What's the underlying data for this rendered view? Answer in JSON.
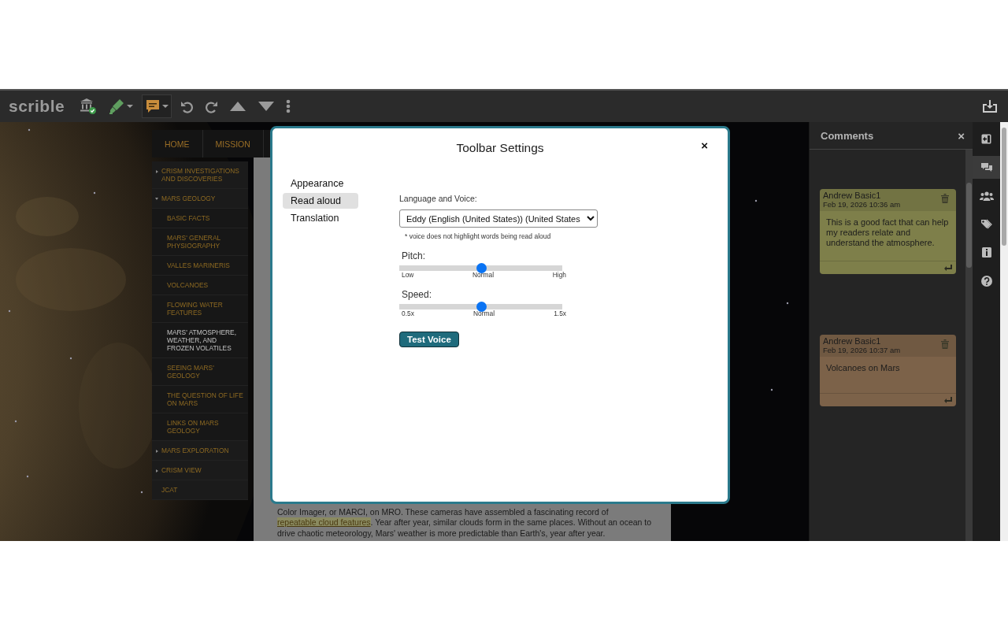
{
  "toolbar": {
    "logo": "scrible",
    "tools": [
      {
        "kind": "library",
        "selected": false,
        "dropdown": false
      },
      {
        "kind": "highlighter",
        "selected": false,
        "dropdown": true
      },
      {
        "kind": "comment",
        "selected": true,
        "dropdown": true
      },
      {
        "kind": "undo",
        "selected": false,
        "dropdown": false
      },
      {
        "kind": "redo",
        "selected": false,
        "dropdown": false
      },
      {
        "kind": "up",
        "selected": false,
        "dropdown": false
      },
      {
        "kind": "down",
        "selected": false,
        "dropdown": false
      },
      {
        "kind": "more",
        "selected": false,
        "dropdown": false
      }
    ],
    "right_tools": [
      {
        "kind": "download",
        "selected": false,
        "dropdown": false
      }
    ]
  },
  "site": {
    "nav": [
      {
        "label": "HOME"
      },
      {
        "label": "MISSION"
      }
    ],
    "sidebar": [
      {
        "label": "CRISM INVESTIGATIONS AND DISCOVERIES",
        "expanded": false
      },
      {
        "label": "MARS GEOLOGY",
        "expanded": true,
        "children": [
          {
            "label": "BASIC FACTS",
            "selected": false
          },
          {
            "label": "MARS' GENERAL PHYSIOGRAPHY",
            "selected": false
          },
          {
            "label": "VALLES MARINERIS",
            "selected": false
          },
          {
            "label": "VOLCANOES",
            "selected": false
          },
          {
            "label": "FLOWING WATER FEATURES",
            "selected": false
          },
          {
            "label": "MARS' ATMOSPHERE, WEATHER, AND FROZEN VOLATILES",
            "selected": true
          },
          {
            "label": "SEEING MARS' GEOLOGY",
            "selected": false
          },
          {
            "label": "THE QUESTION OF LIFE ON MARS",
            "selected": false
          },
          {
            "label": "LINKS ON MARS GEOLOGY",
            "selected": false
          }
        ]
      },
      {
        "label": "MARS EXPLORATION",
        "expanded": false
      },
      {
        "label": "CRISM VIEW",
        "expanded": false
      },
      {
        "label": "JCAT"
      }
    ],
    "article": {
      "paragraph": [
        {
          "kind": "text",
          "text": "Color Imager, or MARCI, on MRO. These cameras have assembled a fascinating record of "
        },
        {
          "kind": "link",
          "text": "repeatable cloud features"
        },
        {
          "kind": "text",
          "text": ". Year after year, similar clouds form in the same places. Without an ocean to drive chaotic meteorology, Mars' weather is more predictable than Earth's, year after year."
        }
      ]
    }
  },
  "comments_panel": {
    "title": "Comments",
    "close": "×",
    "comments": [
      {
        "author": "Andrew Basic1",
        "date": "Feb 19, 2026 10:36 am",
        "text": "This is a good fact that can help my readers relate and understand the atmosphere.",
        "color": "#7e7f4a"
      },
      {
        "author": "Andrew Basic1",
        "date": "Feb 19, 2026 10:37 am",
        "text": "Volcanoes on Mars",
        "color": "#7c6249"
      }
    ]
  },
  "side_rail": [
    {
      "kind": "exit",
      "selected": false
    },
    {
      "kind": "comments",
      "selected": true
    },
    {
      "kind": "people",
      "selected": false
    },
    {
      "kind": "tag",
      "selected": false
    },
    {
      "kind": "info",
      "selected": false
    },
    {
      "kind": "help",
      "selected": false
    }
  ],
  "dialog": {
    "title": "Toolbar Settings",
    "close": "×",
    "menu": [
      {
        "label": "Appearance",
        "selected": false
      },
      {
        "label": "Read aloud",
        "selected": true
      },
      {
        "label": "Translation",
        "selected": false
      }
    ],
    "voice_label": "Language and Voice:",
    "voice": "Eddy (English (United States)) (United States",
    "note": "* voice does not highlight words being read aloud",
    "sliders": [
      {
        "label": "Pitch:",
        "level": 0.5,
        "ticks": [
          "Low",
          "Normal",
          "High"
        ]
      },
      {
        "label": "Speed:",
        "level": 0.5,
        "ticks": [
          "0.5x",
          "Normal",
          "1.5x"
        ]
      }
    ],
    "button": "Test Voice"
  }
}
